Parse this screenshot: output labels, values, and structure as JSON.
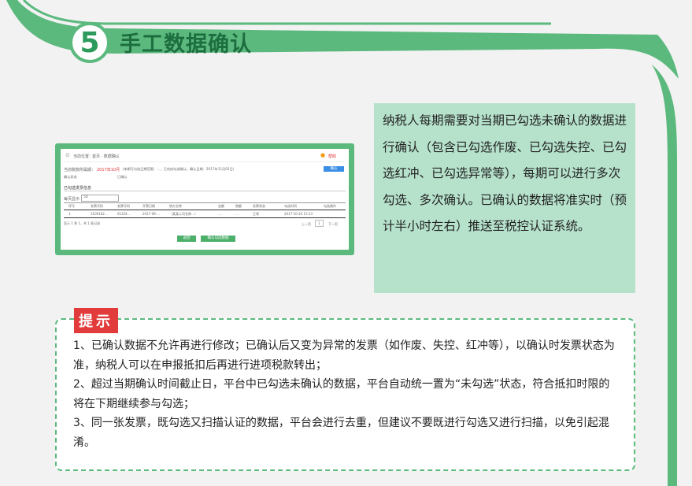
{
  "section": {
    "number": "5",
    "title": "手工数据确认"
  },
  "colors": {
    "green": "#5cb97e",
    "dark_green": "#1d6e3f",
    "pale_green": "#b6e2cc",
    "red": "#e23b3b"
  },
  "screenshot": {
    "location_label": "当前位置：",
    "location_path": "首页 · 数据确认",
    "help": "帮助",
    "period_label": "当前税款所属期：",
    "period_value": "2017年10月",
    "period_note": "（本期可勾选日期范围：…，已完成勾选确认，确认日期：2017年11月02日）",
    "confirm_button": "确认",
    "radio_1": "确认状态",
    "radio_2": "已确认",
    "section_label": "已勾选发票信息",
    "page_size_label": "每页显示",
    "page_size": "50",
    "columns": [
      "序号",
      "发票代码",
      "发票号码",
      "开票日期",
      "销方名称",
      "金额",
      "税额",
      "发票状态",
      "勾选时间",
      "勾选操作"
    ],
    "row": [
      "1",
      "3100162…",
      "01224…",
      "2017-09-…",
      "（某某公司名称…）",
      "…",
      "…",
      "正常",
      "2017-10-24 15:13",
      ""
    ],
    "pager_info": "显示 1 到 1，共 1 条记录",
    "pager_prev": "上一页",
    "pager_page": "1",
    "pager_next": "下一页",
    "btn_back": "返回",
    "btn_submit": "确认勾选数据"
  },
  "description": "纳税人每期需要对当期已勾选未确认的数据进行确认（包含已勾选作废、已勾选失控、已勾选红冲、已勾选异常等），每期可以进行多次勾选、多次确认。已确认的数据将准实时（预计半小时左右）推送至税控认证系统。",
  "tip": {
    "label": "提示",
    "items": [
      "1、已确认数据不允许再进行修改；已确认后又变为异常的发票（如作废、失控、红冲等），以确认时发票状态为准，纳税人可以在申报抵扣后再进行进项税款转出；",
      "2、超过当期确认时间截止日，平台中已勾选未确认的数据，平台自动统一置为“未勾选”状态，符合抵扣时限的将在下期继续参与勾选；",
      "3、同一张发票，既勾选又扫描认证的数据，平台会进行去重，但建议不要既进行勾选又进行扫描，以免引起混淆。"
    ]
  }
}
